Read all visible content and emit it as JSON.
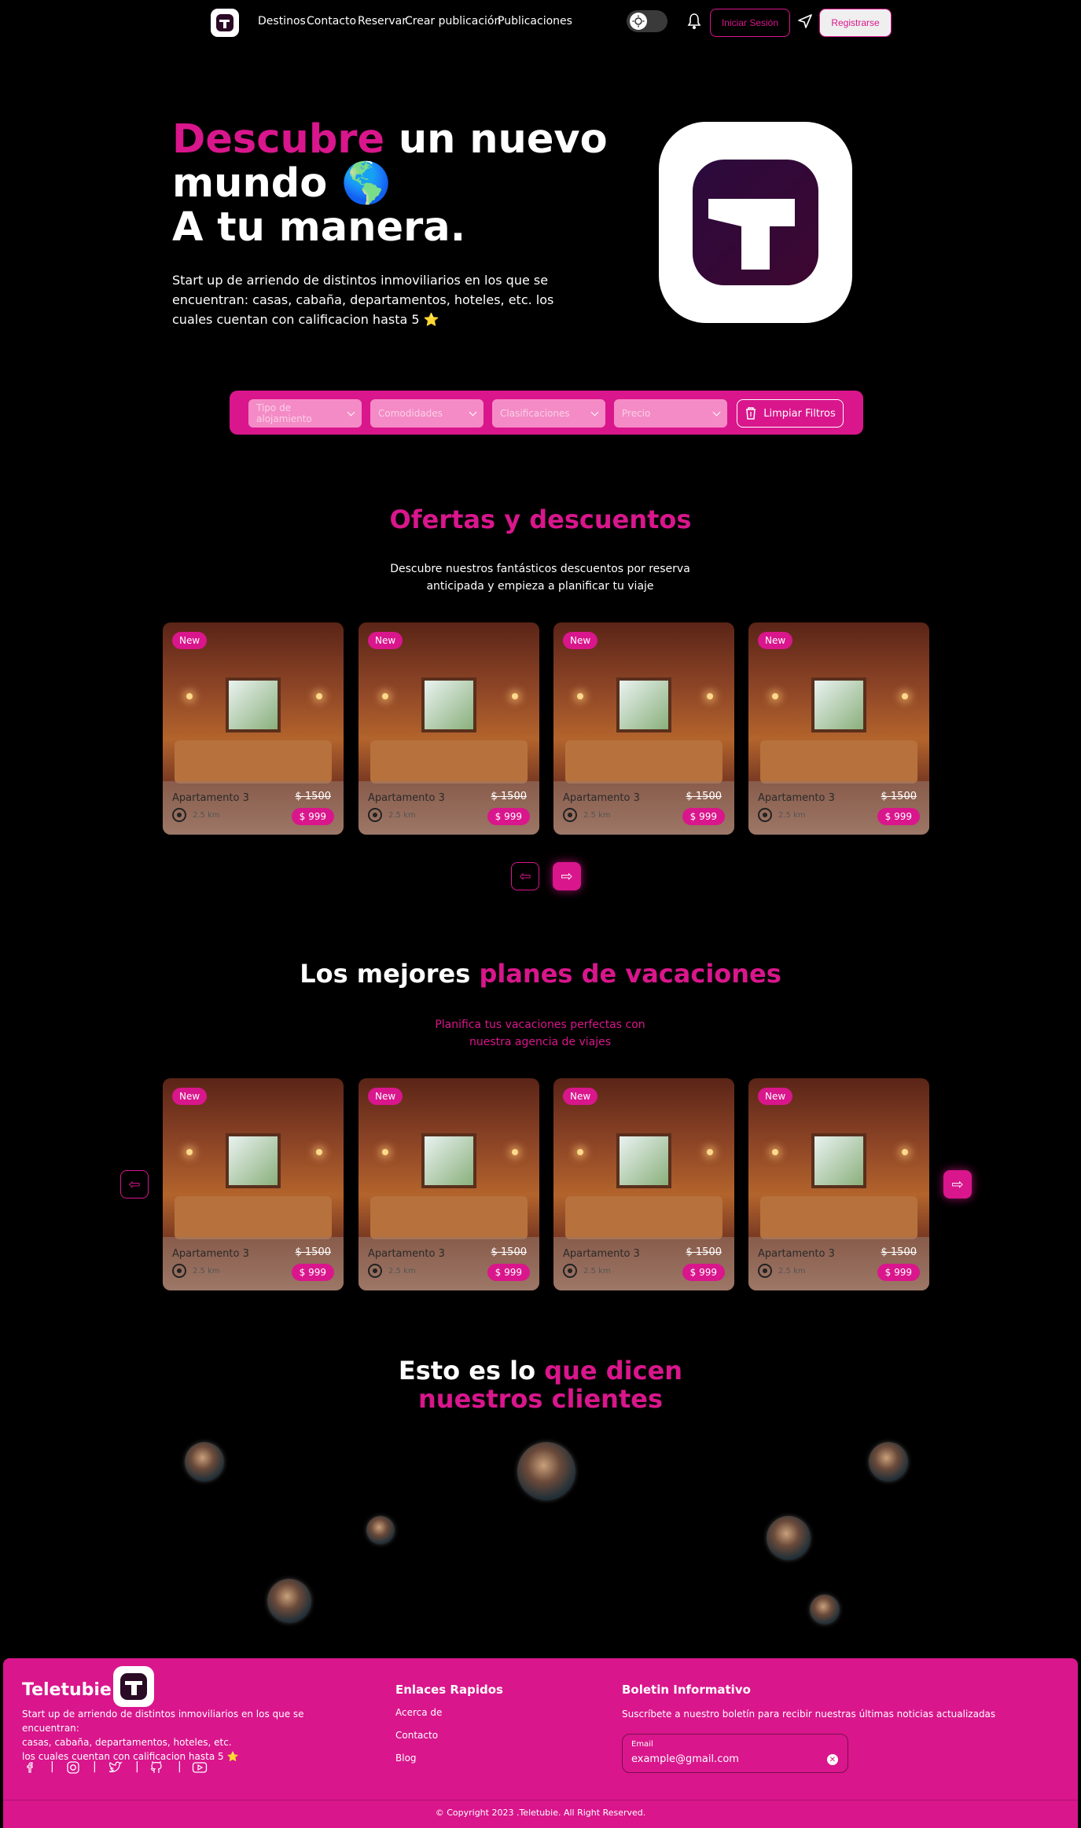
{
  "nav": {
    "links": [
      "Destinos",
      "Contacto",
      "Reservar",
      "Crear publicación",
      "Publicaciones"
    ],
    "login": "Iniciar Sesión",
    "signup": "Registrarse"
  },
  "hero": {
    "title_accent": "Descubre",
    "title_rest_1": " un nuevo",
    "title_line2": "mundo 🌎",
    "title_line3": "A tu manera.",
    "description": "Start up de arriendo de distintos inmoviliarios en los que se encuentran: casas, cabaña, departamentos, hoteles, etc. los cuales cuentan con calificacion hasta 5 ⭐"
  },
  "filters": {
    "type": "Tipo de alojamiento",
    "amenities": "Comodidades",
    "ratings": "Clasificaciones",
    "price": "Precio",
    "clear": "Limpiar Filtros"
  },
  "offers": {
    "title": "Ofertas y descuentos",
    "subtitle_1": "Descubre nuestros fantásticos descuentos por reserva",
    "subtitle_2": "anticipada y empieza a planificar tu viaje"
  },
  "plans": {
    "title_white": "Los mejores ",
    "title_pink": "planes de vacaciones",
    "subtitle_1": "Planifica tus vacaciones perfectas con",
    "subtitle_2": "nuestra agencia de viajes"
  },
  "card": {
    "badge": "New",
    "name": "Apartamento 3",
    "old_price": "$ 1500",
    "distance": "2.5 km",
    "price": "$ 999"
  },
  "testimonials": {
    "title_white": "Esto es lo ",
    "title_pink_1": "que dicen",
    "title_pink_2": "nuestros clientes"
  },
  "footer": {
    "brand": "Teletubie",
    "desc_1": "Start up de arriendo de distintos inmoviliarios en los que se encuentran:",
    "desc_2": "casas, cabaña, departamentos, hoteles, etc.",
    "desc_3": "los cuales cuentan con calificacion hasta 5 ⭐",
    "links_title": "Enlaces Rapidos",
    "links": [
      "Acerca de",
      "Contacto",
      "Blog"
    ],
    "news_title": "Boletin Informativo",
    "news_desc": "Suscríbete a nuestro boletín para recibir nuestras últimas noticias actualizadas",
    "email_label": "Email",
    "email_value": "example@gmail.com",
    "copyright": "© Copyright 2023 .Teletubie. All Right Reserved."
  },
  "colors": {
    "accent": "#d9168c",
    "background": "#000000"
  },
  "icons": [
    "logo-icon",
    "sun-icon",
    "bell-icon",
    "send-icon",
    "trash-icon",
    "location-icon",
    "arrow-left-icon",
    "arrow-right-icon",
    "facebook-icon",
    "instagram-icon",
    "twitter-icon",
    "github-icon",
    "youtube-icon",
    "close-icon"
  ]
}
